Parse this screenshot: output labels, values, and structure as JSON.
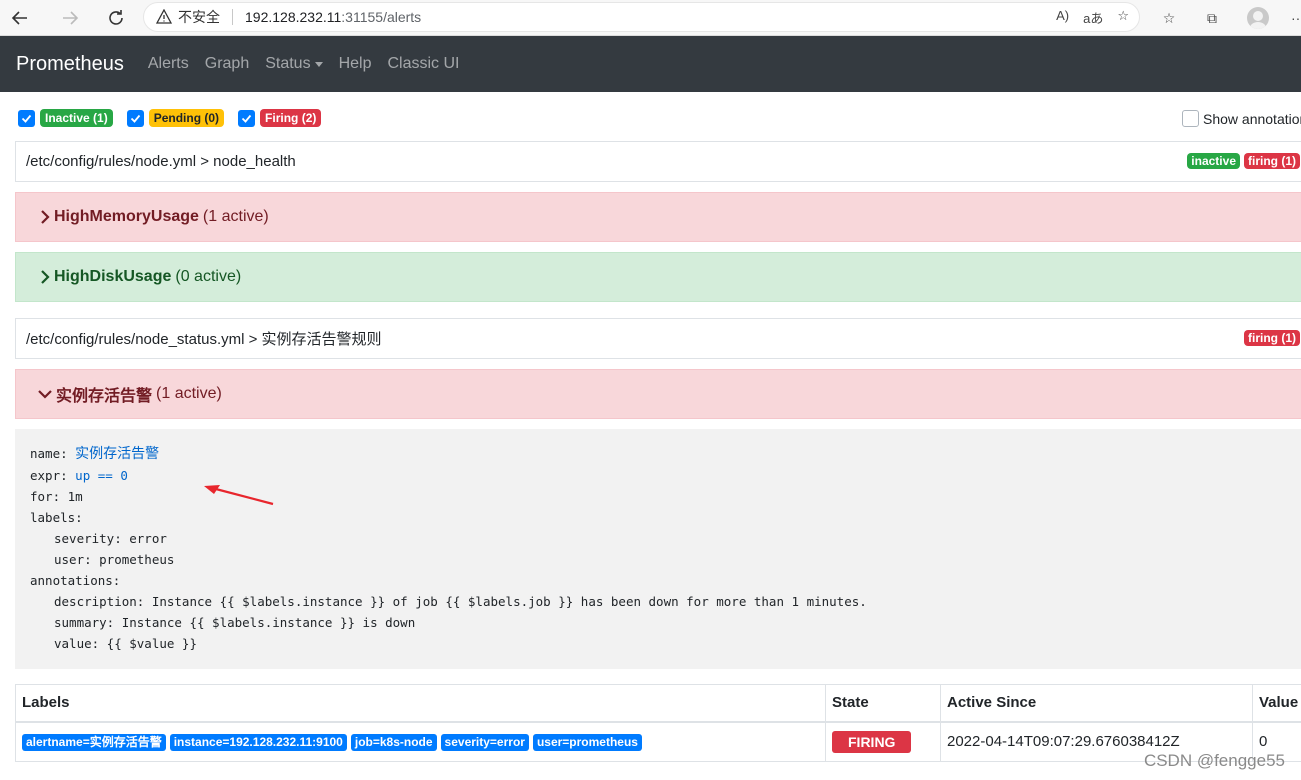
{
  "browser": {
    "security_label": "不安全",
    "url_host": "192.128.232.11",
    "url_path": ":31155/alerts"
  },
  "navbar": {
    "brand": "Prometheus",
    "links": [
      "Alerts",
      "Graph",
      "Status",
      "Help",
      "Classic UI"
    ]
  },
  "filters": {
    "inactive": "Inactive (1)",
    "pending": "Pending (0)",
    "firing": "Firing (2)",
    "show_annotations": "Show annotations"
  },
  "groups": [
    {
      "path": "/etc/config/rules/node.yml > node_health",
      "badges": {
        "inactive": "inactive",
        "firing": "firing (1)"
      },
      "rules": [
        {
          "name": "HighMemoryUsage",
          "count": "(1 active)"
        },
        {
          "name": "HighDiskUsage",
          "count": "(0 active)"
        }
      ]
    },
    {
      "path": "/etc/config/rules/node_status.yml > 实例存活告警规则",
      "badges": {
        "firing": "firing (1)"
      },
      "rules": [
        {
          "name": "实例存活告警",
          "count": "(1 active)"
        }
      ]
    }
  ],
  "rule_yaml": {
    "name_key": "name:",
    "name_val": "实例存活告警",
    "expr_key": "expr:",
    "expr_val": "up == 0",
    "for_line": "for: 1m",
    "labels_key": "labels:",
    "label_severity": "severity: error",
    "label_user": "user: prometheus",
    "annotations_key": "annotations:",
    "ann_description": "description: Instance {{ $labels.instance }} of job {{ $labels.job }} has been down for more than 1 minutes.",
    "ann_summary": "summary: Instance {{ $labels.instance }} is down",
    "ann_value": "value: {{ $value }}"
  },
  "alerts_table": {
    "headers": [
      "Labels",
      "State",
      "Active Since",
      "Value"
    ],
    "rows": [
      {
        "labels": [
          "alertname=实例存活告警",
          "instance=192.128.232.11:9100",
          "job=k8s-node",
          "severity=error",
          "user=prometheus"
        ],
        "state": "FIRING",
        "active_since": "2022-04-14T09:07:29.676038412Z",
        "value": "0"
      }
    ]
  },
  "watermark": "CSDN @fengge55",
  "colors": {
    "navbar": "#343a40",
    "danger_bg": "#f8d7da",
    "success_bg": "#d4edda",
    "badge_red": "#dc3545",
    "badge_green": "#28a745",
    "badge_yellow": "#ffc107",
    "label_blue": "#007bff"
  }
}
